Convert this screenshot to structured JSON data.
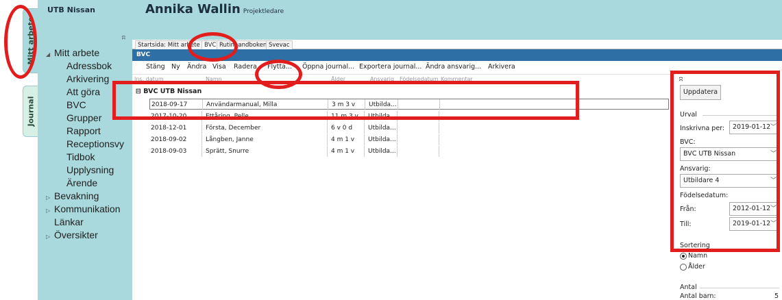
{
  "sidetabs": {
    "active": "Mitt arbete",
    "inactive": "Journal"
  },
  "header": {
    "app": "UTB Nissan",
    "user": "Annika Wallin",
    "role": "Projektledare",
    "pin": "ʭ"
  },
  "nav": {
    "root": "Mitt arbete",
    "children": [
      "Adressbok",
      "Arkivering",
      "Att göra",
      "BVC",
      "Grupper",
      "Rapport",
      "Receptionsvy",
      "Tidbok",
      "Upplysning",
      "Ärende"
    ],
    "others": [
      "Bevakning",
      "Kommunikation",
      "Länkar",
      "Översikter"
    ]
  },
  "tabs": [
    "Startsida: Mitt arbete",
    "BVC",
    "Rutinhandboken",
    "Svevac"
  ],
  "panel_title": "BVC",
  "toolbar": [
    "Stäng",
    "Ny",
    "Ändra",
    "Visa",
    "Radera",
    "Flytta...",
    "Öppna journal...",
    "Exportera journal...",
    "Ändra ansvarig...",
    "Arkivera"
  ],
  "columns": [
    "Ins. datum",
    "Namn",
    "Ålder",
    "Ansvarig",
    "Födelsedatum",
    "Kommentar"
  ],
  "group": "BVC UTB Nissan",
  "rows": [
    {
      "date": "2018-09-17",
      "name": "Användarmanual, Milla",
      "age": "3 m 3 v",
      "resp": "Utbilda..."
    },
    {
      "date": "2017-10-20",
      "name": "Ettåring, Pelle",
      "age": "11 m 3 v",
      "resp": "Utbilda..."
    },
    {
      "date": "2018-12-01",
      "name": "Första, December",
      "age": "6 v 0 d",
      "resp": "Utbilda..."
    },
    {
      "date": "2018-09-02",
      "name": "Långben, Janne",
      "age": "4 m 1 v",
      "resp": "Utbilda..."
    },
    {
      "date": "2018-09-03",
      "name": "Sprätt, Snurre",
      "age": "4 m 1 v",
      "resp": "Utbilda..."
    }
  ],
  "filter": {
    "update_button": "Uppdatera",
    "urval": "Urval",
    "inskrivna_label": "Inskrivna per:",
    "inskrivna_value": "2019-01-12",
    "bvc_label": "BVC:",
    "bvc_value": "BVC UTB Nissan",
    "ansvarig_label": "Ansvarig:",
    "ansvarig_value": "Utbildare 4",
    "fodelse_label": "Födelsedatum:",
    "fran_label": "Från:",
    "fran_value": "2012-01-12",
    "till_label": "Till:",
    "till_value": "2019-01-12",
    "sortering": "Sortering",
    "sort_namn": "Namn",
    "sort_alder": "Ålder",
    "antal": "Antal",
    "antal_barn_label": "Antal barn:",
    "antal_barn_value": "5"
  },
  "highlight_color": "#e21d1d"
}
